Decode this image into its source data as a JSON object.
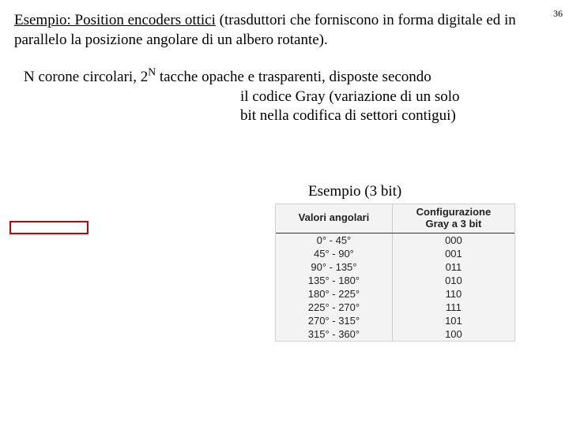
{
  "page_number": "36",
  "para1": {
    "underline": "Esempio: Position encoders ottici",
    "rest": " (trasduttori che forniscono in forma digitale ed in parallelo la posizione angolare di un albero rotante)."
  },
  "para2": {
    "lead_pre": "N corone circolari, 2",
    "lead_sup": "N",
    "lead_post": " tacche opache e trasparenti, disposte secondo",
    "line2": "il codice Gray (variazione di un solo",
    "line3": "bit nella  codifica di settori contigui)"
  },
  "example_label": "Esempio (3 bit)",
  "chart_data": {
    "type": "table",
    "title": "Configurazione Gray a 3 bit per valori angolari",
    "headers": [
      "Valori angolari",
      "Configurazione Gray a 3 bit"
    ],
    "header_col1_line1": "Valori angolari",
    "header_col2_line1": "Configurazione",
    "header_col2_line2": "Gray a 3 bit",
    "rows": [
      {
        "angle": "0° - 45°",
        "code": "000"
      },
      {
        "angle": "45° - 90°",
        "code": "001"
      },
      {
        "angle": "90° - 135°",
        "code": "011"
      },
      {
        "angle": "135° - 180°",
        "code": "010"
      },
      {
        "angle": "180° - 225°",
        "code": "110"
      },
      {
        "angle": "225° - 270°",
        "code": "111"
      },
      {
        "angle": "270° - 315°",
        "code": "101"
      },
      {
        "angle": "315° - 360°",
        "code": "100"
      }
    ]
  }
}
